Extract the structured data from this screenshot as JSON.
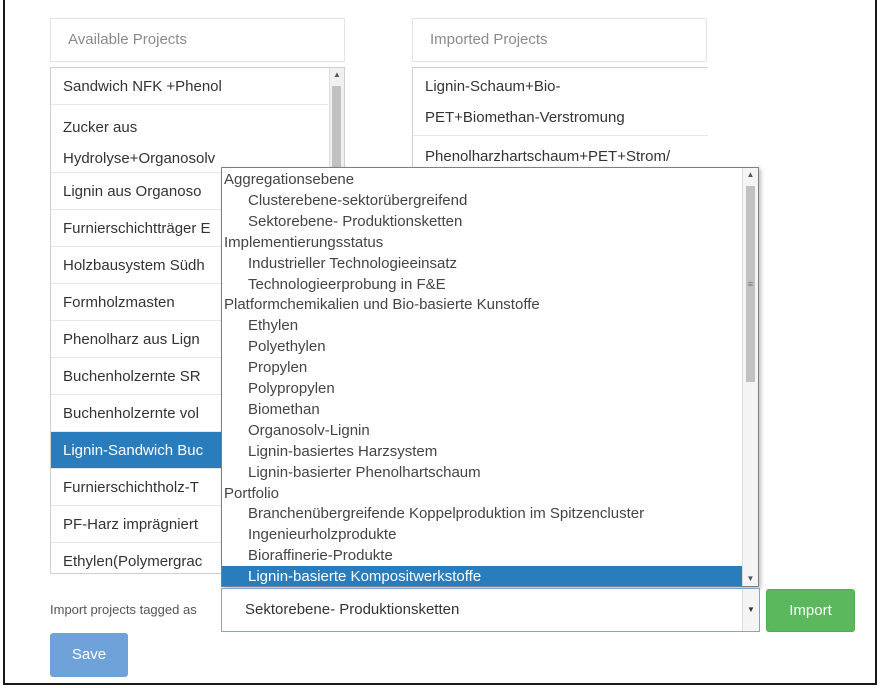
{
  "available": {
    "heading": "Available Projects",
    "items": [
      {
        "lines": [
          "Sandwich NFK +Phenol"
        ],
        "selected": false
      },
      {
        "lines": [
          "Zucker aus",
          "Hydrolyse+Organosolv"
        ],
        "selected": false
      },
      {
        "lines": [
          "Lignin aus Organoso"
        ],
        "selected": false
      },
      {
        "lines": [
          "Furnierschichtträger E"
        ],
        "selected": false
      },
      {
        "lines": [
          "Holzbausystem Südh"
        ],
        "selected": false
      },
      {
        "lines": [
          "Formholzmasten"
        ],
        "selected": false
      },
      {
        "lines": [
          "Phenolharz aus Lign"
        ],
        "selected": false
      },
      {
        "lines": [
          "Buchenholzernte SR"
        ],
        "selected": false
      },
      {
        "lines": [
          "Buchenholzernte vol"
        ],
        "selected": false
      },
      {
        "lines": [
          "Lignin-Sandwich Buc"
        ],
        "selected": true
      },
      {
        "lines": [
          "Furnierschichtholz-T"
        ],
        "selected": false
      },
      {
        "lines": [
          "PF-Harz imprägniert"
        ],
        "selected": false
      },
      {
        "lines": [
          "Ethylen(Polymergrac"
        ],
        "selected": false
      }
    ]
  },
  "imported": {
    "heading": "Imported Projects",
    "items": [
      {
        "lines": [
          "Lignin-Schaum+Bio-",
          "PET+Biomethan-Verstromung"
        ]
      },
      {
        "lines": [
          "Phenolharzhartschaum+PET+Strom/"
        ]
      }
    ]
  },
  "dropdown": {
    "options": [
      {
        "label": "Aggregationsebene",
        "type": "group"
      },
      {
        "label": "Clusterebene-sektorübergreifend",
        "type": "child"
      },
      {
        "label": "Sektorebene- Produktionsketten",
        "type": "child"
      },
      {
        "label": "Implementierungsstatus",
        "type": "group"
      },
      {
        "label": "Industrieller Technologieeinsatz",
        "type": "child"
      },
      {
        "label": "Technologieerprobung in F&E",
        "type": "child"
      },
      {
        "label": "Platformchemikalien und Bio-basierte Kunstoffe",
        "type": "group"
      },
      {
        "label": "Ethylen",
        "type": "child"
      },
      {
        "label": "Polyethylen",
        "type": "child"
      },
      {
        "label": "Propylen",
        "type": "child"
      },
      {
        "label": "Polypropylen",
        "type": "child"
      },
      {
        "label": "Biomethan",
        "type": "child"
      },
      {
        "label": "Organosolv-Lignin",
        "type": "child"
      },
      {
        "label": "Lignin-basiertes Harzsystem",
        "type": "child"
      },
      {
        "label": "Lignin-basierter Phenolhartschaum",
        "type": "child"
      },
      {
        "label": "Portfolio",
        "type": "group"
      },
      {
        "label": "Branchenübergreifende Koppelproduktion im Spitzencluster",
        "type": "child"
      },
      {
        "label": "Ingenieurholzprodukte",
        "type": "child"
      },
      {
        "label": "Bioraffinerie-Produkte",
        "type": "child"
      },
      {
        "label": "Lignin-basierte Kompositwerkstoffe",
        "type": "child",
        "highlighted": true
      }
    ]
  },
  "tag_label": "Import projects tagged as",
  "select_value": "Sektorebene- Produktionsketten",
  "import_label": "Import",
  "save_label": "Save",
  "colors": {
    "selected": "#2a7dbd",
    "import": "#5cb85c",
    "save": "#6fa2d8"
  }
}
